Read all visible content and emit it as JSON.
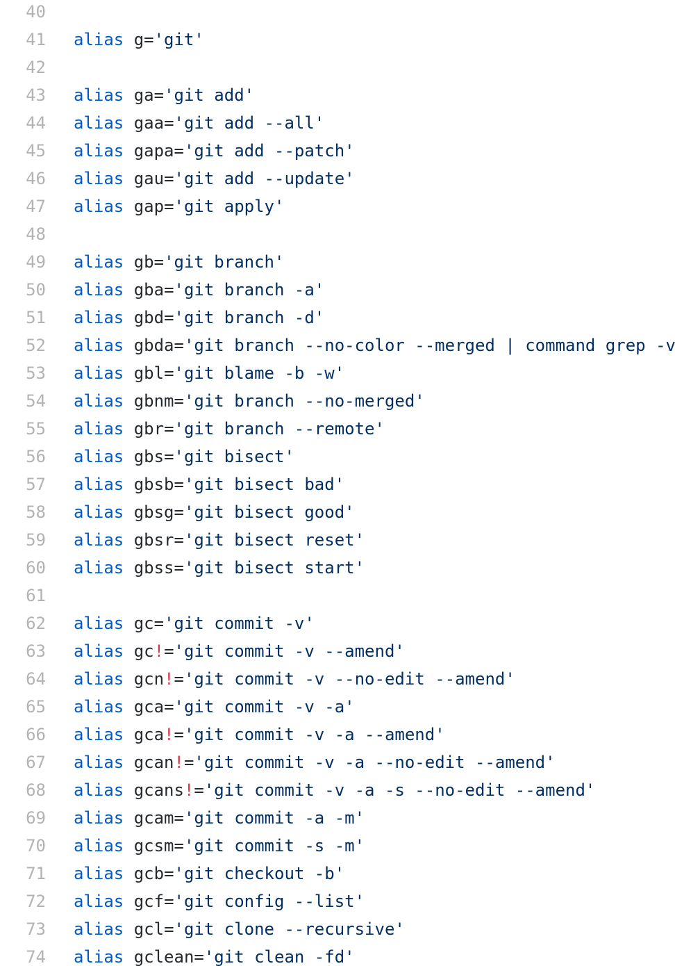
{
  "colors": {
    "line_number": "#b3b3b3",
    "keyword": "#005cc5",
    "identifier": "#24292e",
    "bang": "#d73a49",
    "string": "#032f62",
    "background": "#ffffff"
  },
  "lines": [
    {
      "n": "40",
      "kw": "",
      "name": "",
      "bang": "",
      "eq": "",
      "str": ""
    },
    {
      "n": "41",
      "kw": "alias",
      "name": "g",
      "bang": "",
      "eq": "=",
      "str": "'git'"
    },
    {
      "n": "42",
      "kw": "",
      "name": "",
      "bang": "",
      "eq": "",
      "str": ""
    },
    {
      "n": "43",
      "kw": "alias",
      "name": "ga",
      "bang": "",
      "eq": "=",
      "str": "'git add'"
    },
    {
      "n": "44",
      "kw": "alias",
      "name": "gaa",
      "bang": "",
      "eq": "=",
      "str": "'git add --all'"
    },
    {
      "n": "45",
      "kw": "alias",
      "name": "gapa",
      "bang": "",
      "eq": "=",
      "str": "'git add --patch'"
    },
    {
      "n": "46",
      "kw": "alias",
      "name": "gau",
      "bang": "",
      "eq": "=",
      "str": "'git add --update'"
    },
    {
      "n": "47",
      "kw": "alias",
      "name": "gap",
      "bang": "",
      "eq": "=",
      "str": "'git apply'"
    },
    {
      "n": "48",
      "kw": "",
      "name": "",
      "bang": "",
      "eq": "",
      "str": ""
    },
    {
      "n": "49",
      "kw": "alias",
      "name": "gb",
      "bang": "",
      "eq": "=",
      "str": "'git branch'"
    },
    {
      "n": "50",
      "kw": "alias",
      "name": "gba",
      "bang": "",
      "eq": "=",
      "str": "'git branch -a'"
    },
    {
      "n": "51",
      "kw": "alias",
      "name": "gbd",
      "bang": "",
      "eq": "=",
      "str": "'git branch -d'"
    },
    {
      "n": "52",
      "kw": "alias",
      "name": "gbda",
      "bang": "",
      "eq": "=",
      "str": "'git branch --no-color --merged | command grep -v"
    },
    {
      "n": "53",
      "kw": "alias",
      "name": "gbl",
      "bang": "",
      "eq": "=",
      "str": "'git blame -b -w'"
    },
    {
      "n": "54",
      "kw": "alias",
      "name": "gbnm",
      "bang": "",
      "eq": "=",
      "str": "'git branch --no-merged'"
    },
    {
      "n": "55",
      "kw": "alias",
      "name": "gbr",
      "bang": "",
      "eq": "=",
      "str": "'git branch --remote'"
    },
    {
      "n": "56",
      "kw": "alias",
      "name": "gbs",
      "bang": "",
      "eq": "=",
      "str": "'git bisect'"
    },
    {
      "n": "57",
      "kw": "alias",
      "name": "gbsb",
      "bang": "",
      "eq": "=",
      "str": "'git bisect bad'"
    },
    {
      "n": "58",
      "kw": "alias",
      "name": "gbsg",
      "bang": "",
      "eq": "=",
      "str": "'git bisect good'"
    },
    {
      "n": "59",
      "kw": "alias",
      "name": "gbsr",
      "bang": "",
      "eq": "=",
      "str": "'git bisect reset'"
    },
    {
      "n": "60",
      "kw": "alias",
      "name": "gbss",
      "bang": "",
      "eq": "=",
      "str": "'git bisect start'"
    },
    {
      "n": "61",
      "kw": "",
      "name": "",
      "bang": "",
      "eq": "",
      "str": ""
    },
    {
      "n": "62",
      "kw": "alias",
      "name": "gc",
      "bang": "",
      "eq": "=",
      "str": "'git commit -v'"
    },
    {
      "n": "63",
      "kw": "alias",
      "name": "gc",
      "bang": "!",
      "eq": "=",
      "str": "'git commit -v --amend'"
    },
    {
      "n": "64",
      "kw": "alias",
      "name": "gcn",
      "bang": "!",
      "eq": "=",
      "str": "'git commit -v --no-edit --amend'"
    },
    {
      "n": "65",
      "kw": "alias",
      "name": "gca",
      "bang": "",
      "eq": "=",
      "str": "'git commit -v -a'"
    },
    {
      "n": "66",
      "kw": "alias",
      "name": "gca",
      "bang": "!",
      "eq": "=",
      "str": "'git commit -v -a --amend'"
    },
    {
      "n": "67",
      "kw": "alias",
      "name": "gcan",
      "bang": "!",
      "eq": "=",
      "str": "'git commit -v -a --no-edit --amend'"
    },
    {
      "n": "68",
      "kw": "alias",
      "name": "gcans",
      "bang": "!",
      "eq": "=",
      "str": "'git commit -v -a -s --no-edit --amend'"
    },
    {
      "n": "69",
      "kw": "alias",
      "name": "gcam",
      "bang": "",
      "eq": "=",
      "str": "'git commit -a -m'"
    },
    {
      "n": "70",
      "kw": "alias",
      "name": "gcsm",
      "bang": "",
      "eq": "=",
      "str": "'git commit -s -m'"
    },
    {
      "n": "71",
      "kw": "alias",
      "name": "gcb",
      "bang": "",
      "eq": "=",
      "str": "'git checkout -b'"
    },
    {
      "n": "72",
      "kw": "alias",
      "name": "gcf",
      "bang": "",
      "eq": "=",
      "str": "'git config --list'"
    },
    {
      "n": "73",
      "kw": "alias",
      "name": "gcl",
      "bang": "",
      "eq": "=",
      "str": "'git clone --recursive'"
    },
    {
      "n": "74",
      "kw": "alias",
      "name": "gclean",
      "bang": "",
      "eq": "=",
      "str": "'git clean -fd'"
    }
  ]
}
